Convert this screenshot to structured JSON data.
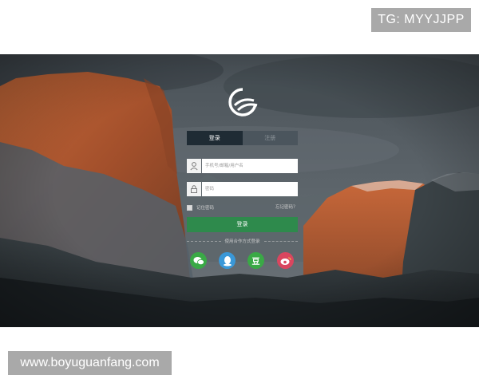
{
  "watermarks": {
    "top_tag": "TG: MYYJJPP",
    "bottom_url": "www.boyuguanfang.com"
  },
  "login": {
    "tabs": [
      {
        "label": "登录",
        "active": true
      },
      {
        "label": "注册",
        "active": false
      }
    ],
    "username_placeholder": "手机号/邮箱/用户名",
    "password_placeholder": "密码",
    "remember_label": "记住密码",
    "forgot_label": "忘记密码？",
    "submit_label": "登录",
    "divider_text": "使用合作方式登录"
  },
  "icons": {
    "logo": "brand-logo-icon",
    "user": "user-icon",
    "lock": "lock-icon",
    "social": [
      "wechat-icon",
      "qq-icon",
      "douban-icon",
      "weibo-icon"
    ]
  },
  "colors": {
    "primary_green": "#2e8a4c",
    "wechat": "#3aa946",
    "qq": "#3a98d8",
    "douban": "#3aa946",
    "weibo": "#d9465f",
    "watermark_bg": "#a9a9a9"
  },
  "social_glyphs": {
    "douban": "豆"
  }
}
